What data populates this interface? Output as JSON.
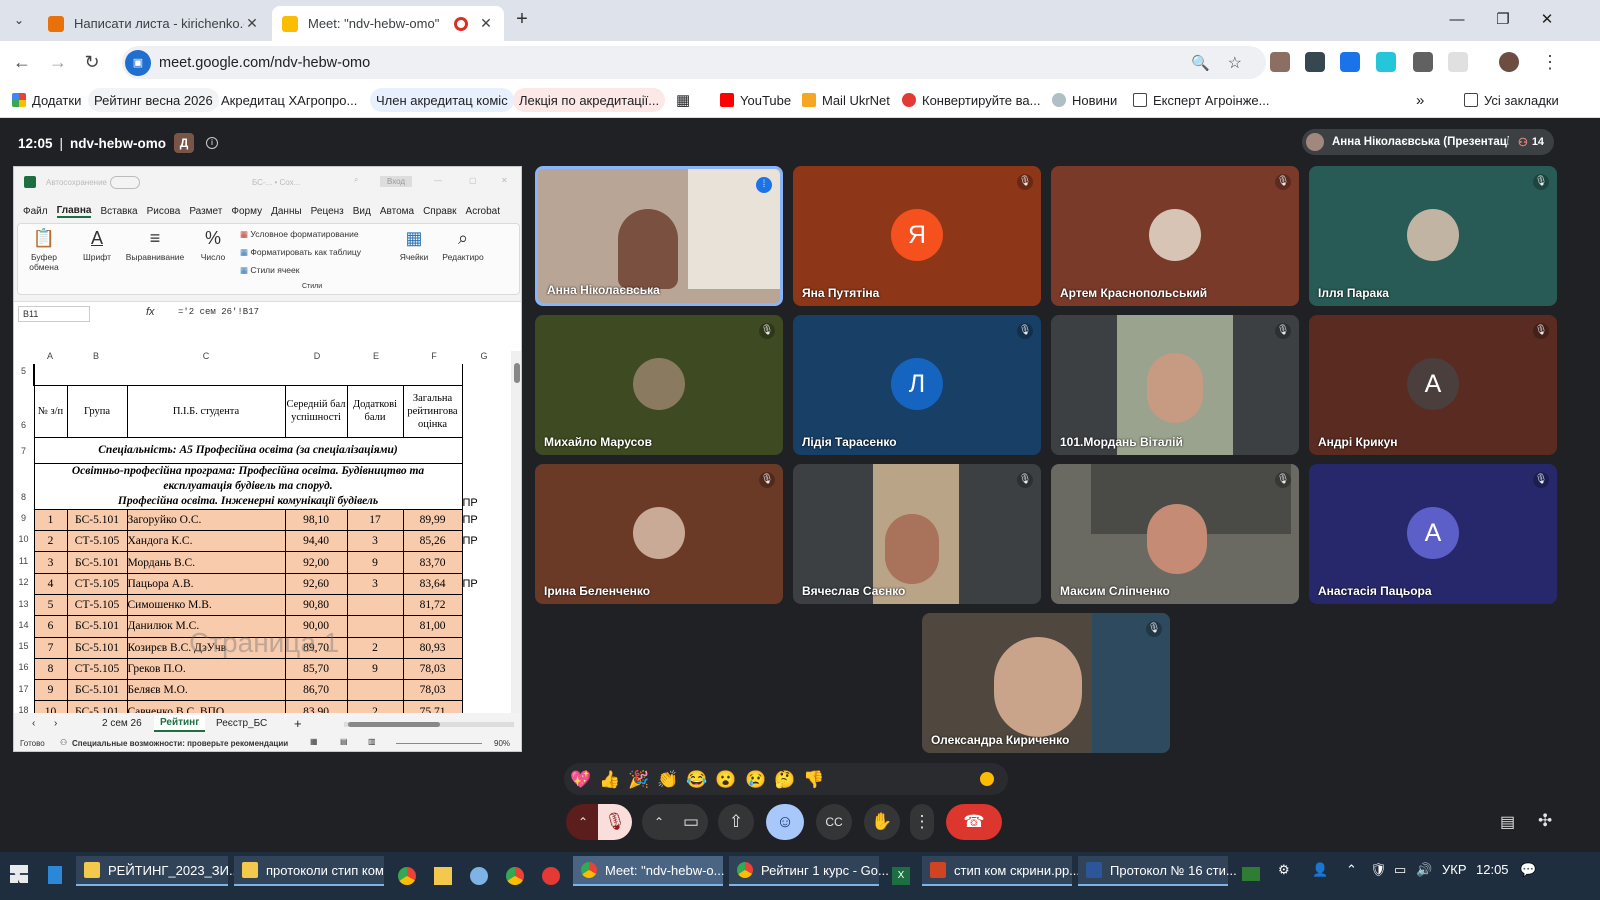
{
  "browser": {
    "tabs": [
      {
        "title": "Написати листа - kirichenko.ol"
      },
      {
        "title": "Meet: \"ndv-hebw-omo\""
      }
    ],
    "url": "meet.google.com/ndv-hebw-omo",
    "bookmarks": [
      "Додатки",
      "Рейтинг весна 2026",
      "Акредитац ХАгропро...",
      "Член акредитац коміс",
      "Лекція по акредитації...",
      "YouTube",
      "Mail UkrNet",
      "Конвертируйте ва...",
      "Новини",
      "Експерт Агроінже..."
    ],
    "all_bookmarks": "Усі закладки"
  },
  "meet": {
    "time": "12:05",
    "separator": "|",
    "code": "ndv-hebw-omo",
    "presenter": "Анна Ніколаєвська (Презентація)",
    "people_count": "14",
    "participants": [
      "Анна Ніколаєвська",
      "Яна Путятіна",
      "Артем Краснопольський",
      "Ілля Парака",
      "Михайло Марусов",
      "Лідія Тарасенко",
      "101.Мордань Віталій",
      "Андрі Крикун",
      "Ірина Беленченко",
      "Вячеслав Саєнко",
      "Максим Сліпченко",
      "Анастасія Пацьора",
      "Олександра Кириченко"
    ],
    "avatars": {
      "Яна Путятіна": "Я",
      "Лідія Тарасенко": "Л",
      "Андрі Крикун": "А",
      "Анастасія Пацьора": "А"
    },
    "reactions": [
      "💖",
      "👍",
      "🎉",
      "👏",
      "😂",
      "😮",
      "😢",
      "🤔",
      "👎"
    ]
  },
  "excel": {
    "autosave": "Автосохранение",
    "filename": "БС-... • Сох...",
    "login": "Вход",
    "ribbon_tabs": [
      "Файл",
      "Главна",
      "Вставка",
      "Рисова",
      "Размет",
      "Форму",
      "Данны",
      "Реценз",
      "Вид",
      "Автома",
      "Справк",
      "Acrobat"
    ],
    "ribbon_groups": [
      "Буфер обмена",
      "Шрифт",
      "Выравнивание",
      "Число",
      "Условное форматирование",
      "Форматировать как таблицу",
      "Стили ячеек",
      "Стили",
      "Ячейки",
      "Редактиро"
    ],
    "cell_ref": "B11",
    "formula": "='2 сем 26'!B17",
    "columns": [
      "A",
      "B",
      "C",
      "D",
      "E",
      "F",
      "G"
    ],
    "row_numbers": [
      "5",
      "6",
      "7",
      "8",
      "9",
      "10",
      "11",
      "12",
      "13",
      "14",
      "15",
      "16",
      "17",
      "18"
    ],
    "header": {
      "num": "№ з/п",
      "group": "Група",
      "name": "П.І.Б. студента",
      "avg": "Середній бал успішності",
      "extra": "Додаткові бали",
      "total": "Загальна рейтингова оцінка"
    },
    "specialty": "Спеціальність:  А5 Професійна освіта (за спеціалізаціями)",
    "program1": "Освітньо-професійна програма: Професійна освіта. Будівництво та",
    "program2": "експлуатація будівель та споруд.",
    "program3": "Професійна освіта. Інженерні комунікації будівель",
    "program_mark": "ПР",
    "rows": [
      {
        "n": "1",
        "g": "БС-5.101",
        "name": "Загоруйко О.С.",
        "avg": "98,10",
        "extra": "17",
        "total": "89,99",
        "mark": "ПР"
      },
      {
        "n": "2",
        "g": "СТ-5.105",
        "name": "Хандога К.С.",
        "avg": "94,40",
        "extra": "3",
        "total": "85,26",
        "mark": "ПР"
      },
      {
        "n": "3",
        "g": "БС-5.101",
        "name": "Мордань В.С.",
        "avg": "92,00",
        "extra": "9",
        "total": "83,70",
        "mark": ""
      },
      {
        "n": "4",
        "g": "СТ-5.105",
        "name": "Пацьора А.В.",
        "avg": "92,60",
        "extra": "3",
        "total": "83,64",
        "mark": "ПР"
      },
      {
        "n": "5",
        "g": "СТ-5.105",
        "name": "Симошенко М.В.",
        "avg": "90,80",
        "extra": "",
        "total": "81,72",
        "mark": ""
      },
      {
        "n": "6",
        "g": "БС-5.101",
        "name": "Данилюк М.С.",
        "avg": "90,00",
        "extra": "",
        "total": "81,00",
        "mark": ""
      },
      {
        "n": "7",
        "g": "БС-5.101",
        "name": "Козирєв В.С.      ДзУчв",
        "avg": "89,70",
        "extra": "2",
        "total": "80,93",
        "mark": ""
      },
      {
        "n": "8",
        "g": "СТ-5.105",
        "name": "Греков П.О.",
        "avg": "85,70",
        "extra": "9",
        "total": "78,03",
        "mark": ""
      },
      {
        "n": "9",
        "g": "БС-5.101",
        "name": "Беляєв М.О.",
        "avg": "86,70",
        "extra": "",
        "total": "78,03",
        "mark": ""
      },
      {
        "n": "10",
        "g": "БС-5.101",
        "name": "Савченко В.С.      ВПО",
        "avg": "83,90",
        "extra": "2",
        "total": "75,71",
        "mark": ""
      }
    ],
    "watermark": "Страница 1",
    "sheets": [
      "2 сем 26",
      "Рейтинг",
      "Реєстр_БС"
    ],
    "status": "Готово",
    "accessibility": "Специальные возможности: проверьте рекомендации",
    "zoom": "90%"
  },
  "taskbar": {
    "items": [
      "РЕЙТИНГ_2023_ЗИ...",
      "протоколи стип ком",
      "Meet: \"ndv-hebw-o...",
      "Рейтинг 1 курс - Go...",
      "стип ком скрини.pp...",
      "Протокол № 16 сти..."
    ],
    "lang": "УКР",
    "clock": "12:05"
  }
}
